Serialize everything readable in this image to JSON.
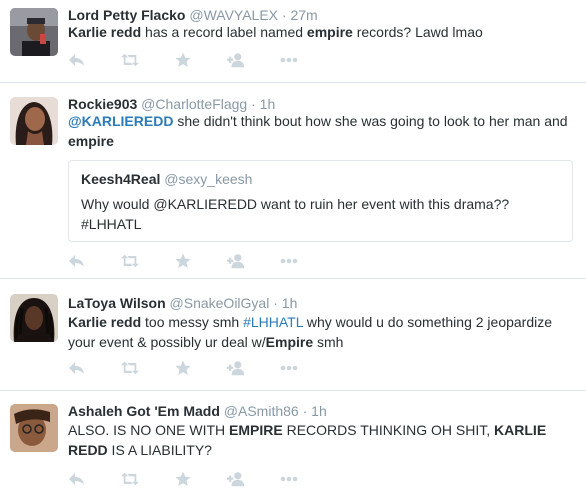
{
  "icons": {
    "reply": "reply-icon",
    "retweet": "retweet-icon",
    "favorite": "star-icon",
    "follow": "follow-user-icon",
    "more": "more-icon"
  },
  "colors": {
    "text": "#292f33",
    "muted": "#8899a6",
    "link": "#2b7bb9",
    "icon": "#ccd6dd",
    "border": "#e1e8ed"
  },
  "tweets": [
    {
      "name": "Lord Petty Flacko",
      "handle": "@WAVYALEX",
      "sep": "·",
      "time": "27m",
      "text": [
        {
          "t": "Karlie redd",
          "b": true
        },
        {
          "t": " has a record label named "
        },
        {
          "t": "empire",
          "b": true
        },
        {
          "t": " records? Lawd lmao"
        }
      ]
    },
    {
      "name": "Rockie903",
      "handle": "@CharlotteFlagg",
      "sep": "·",
      "time": "1h",
      "text": [
        {
          "t": "@KARLIEREDD",
          "link": true,
          "b": true
        },
        {
          "t": " she didn't think bout how she was going to look to her man and "
        },
        {
          "t": "empire",
          "b": true
        }
      ],
      "quote": {
        "name": "Keesh4Real",
        "handle": "@sexy_keesh",
        "text": "Why would @KARLIEREDD  want to ruin her event with this drama?? #LHHATL"
      }
    },
    {
      "name": "LaToya Wilson",
      "handle": "@SnakeOilGyal",
      "sep": "·",
      "time": "1h",
      "text": [
        {
          "t": "Karlie redd",
          "b": true
        },
        {
          "t": " too messy smh "
        },
        {
          "t": "#LHHATL",
          "link": true
        },
        {
          "t": " why would u do something 2 jeopardize your event & possibly ur deal w/"
        },
        {
          "t": "Empire",
          "b": true
        },
        {
          "t": " smh"
        }
      ]
    },
    {
      "name": "Ashaleh Got 'Em Madd",
      "handle": "@ASmith86",
      "sep": "·",
      "time": "1h",
      "text": [
        {
          "t": "ALSO. IS NO ONE WITH "
        },
        {
          "t": "EMPIRE",
          "b": true
        },
        {
          "t": " RECORDS THINKING OH SHIT, "
        },
        {
          "t": "KARLIE REDD",
          "b": true
        },
        {
          "t": " IS A LIABILITY?"
        }
      ]
    }
  ]
}
